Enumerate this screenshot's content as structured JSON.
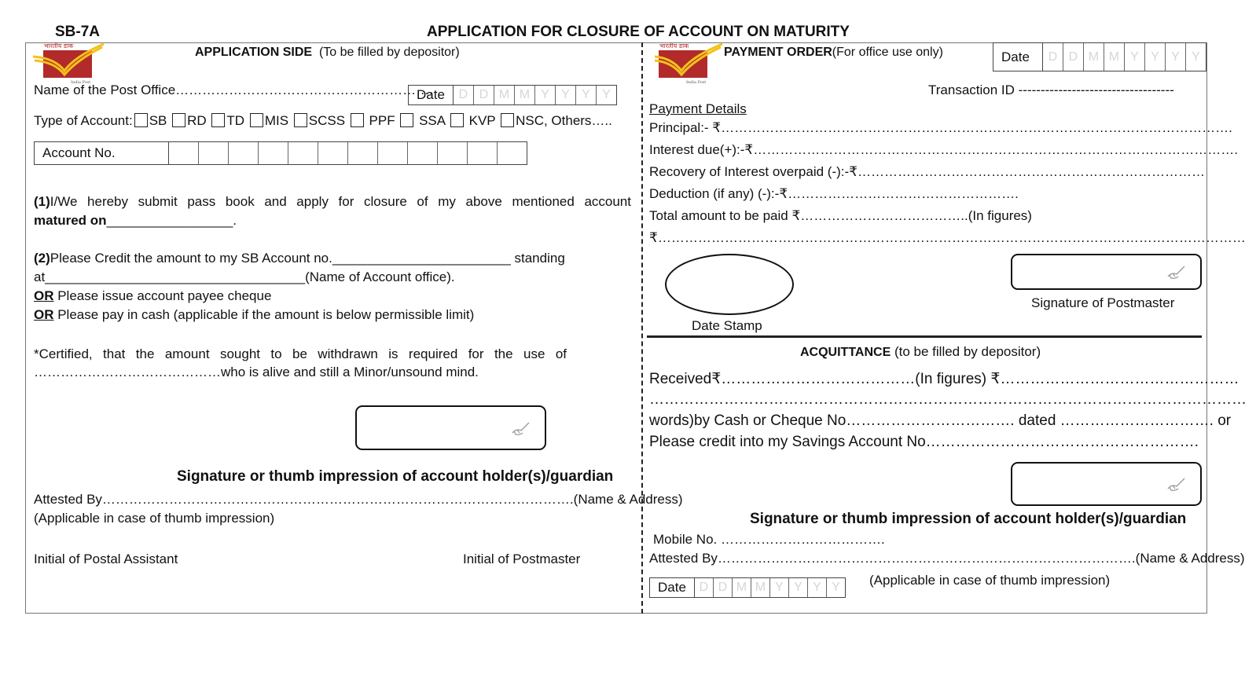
{
  "form_code": "SB-7A",
  "form_title": "APPLICATION FOR CLOSURE OF ACCOUNT ON MATURITY",
  "logo": {
    "icon": "india-post-logo",
    "brand_color": "#b22a2a",
    "accent_color": "#f2c21b",
    "caption": "India Post"
  },
  "date_placeholders": [
    "D",
    "D",
    "M",
    "M",
    "Y",
    "Y",
    "Y",
    "Y"
  ],
  "date_label": "Date",
  "application": {
    "heading_bold": "APPLICATION SIDE",
    "heading_note": "(To be filled by depositor)",
    "post_office_label": "Name of the Post Office………………………………………………….",
    "type_label": "Type of Account:",
    "account_types": [
      "SB",
      "RD",
      "TD",
      "MIS",
      "SCSS",
      " PPF",
      " SSA",
      " KVP",
      "NSC, Others….."
    ],
    "account_no_label": "Account No.",
    "account_no_boxes": 12,
    "para1_num": "(1)",
    "para1_text": "I/We hereby submit pass book and apply for closure of my above mentioned account",
    "para1_bold": "matured on",
    "para1_blank": "_________________.",
    "para2_num": "(2)",
    "para2_line1": "Please Credit the amount to my SB Account no.________________________ standing",
    "para2_line2": "at___________________________________(Name of Account office).",
    "or_label": "OR",
    "or1_text": " Please issue account payee cheque",
    "or2_text": " Please pay in cash (applicable if the amount is below permissible limit)",
    "certified_line1": "*Certified, that the amount sought to be withdrawn is required for the use of",
    "certified_line2": "……………………………………who is alive and still a Minor/unsound mind.",
    "signature_caption": "Signature or thumb impression of account holder(s)/guardian",
    "attested_by": "Attested By…………………………………………………………………………………………….(Name & Address)",
    "applicable_note": "(Applicable in case of thumb impression)",
    "initial_pa": "Initial of Postal Assistant",
    "initial_pm": "Initial of Postmaster"
  },
  "payment": {
    "heading_bold": "PAYMENT ORDER",
    "heading_note": "(For office use only)",
    "transaction_id": "Transaction ID -----------------------------------",
    "details_heading": "Payment Details",
    "lines": [
      "Principal:- ₹…………………………………………………………………………………………………….",
      "Interest due(+):-₹……………………………………………………………………………………………….",
      "Recovery of Interest overpaid (-):-₹……………………………………………………………………",
      "Deduction (if any) (-):-₹…………………………………………….",
      "Total amount to be paid ₹………………………………..(In figures)",
      "₹…………………………………………………………………………………………………………………….(in words)"
    ],
    "date_stamp": "Date Stamp",
    "pm_signature": "Signature of Postmaster"
  },
  "acquittance": {
    "heading_bold": "ACQUITTANCE",
    "heading_note": " (to be filled by depositor)",
    "line1": "Received₹…………………………………(In figures) ₹…………………………………………",
    "line2": "……………………………………………………………………………………………………………….(in",
    "line3": "words)by Cash or Cheque No……………………………. dated …………………………. or",
    "line4": "Please credit into my Savings Account No……………………………………………….",
    "signature_caption": "Signature or thumb impression of account holder(s)/guardian",
    "mobile": "Mobile No. ……………………………….",
    "attested_by": "Attested By………………………………………………………………………………….(Name & Address)",
    "applicable_note": "(Applicable in case of thumb impression)"
  }
}
